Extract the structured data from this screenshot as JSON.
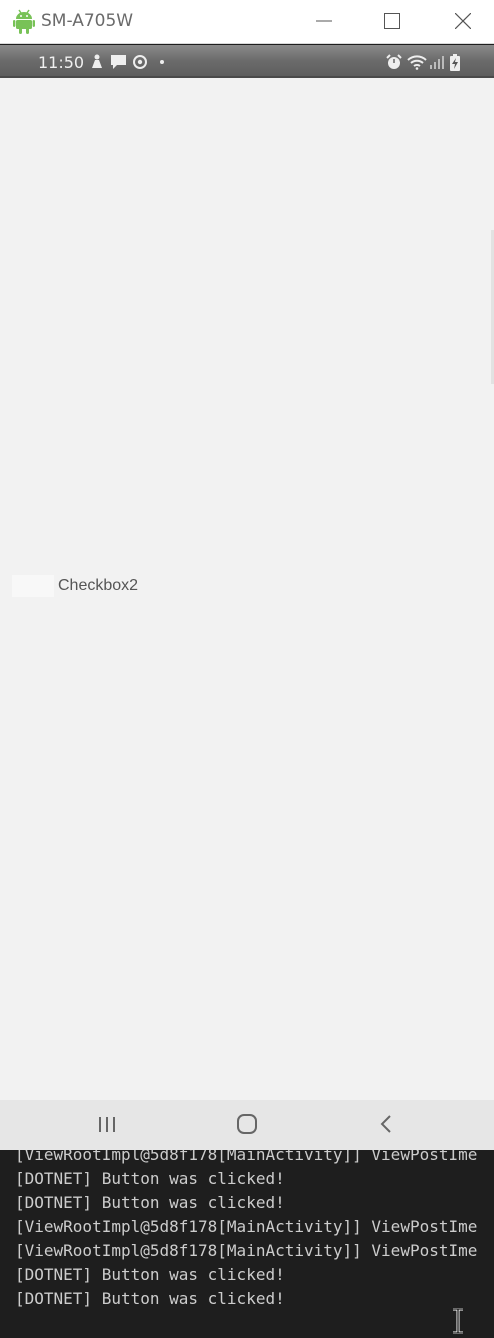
{
  "window": {
    "title": "SM-A705W",
    "icon": "android-icon",
    "controls": [
      "minimize-icon",
      "maximize-icon",
      "close-icon"
    ]
  },
  "status_bar": {
    "time": "11:50",
    "left_icons": [
      "notification-icon",
      "message-icon",
      "sync-icon",
      "dot-icon"
    ],
    "right_icons": [
      "alarm-icon",
      "wifi-icon",
      "signal-icon",
      "battery-charging-icon"
    ]
  },
  "screen": {
    "checkbox": {
      "label": "Checkbox2",
      "checked": false
    }
  },
  "nav_bar": {
    "icons": [
      "recents-icon",
      "home-icon",
      "back-icon"
    ]
  },
  "console": {
    "lines": [
      "[ViewRootImpl@5d8f178[MainActivity]] ViewPostIme",
      "[DOTNET] Button was clicked!",
      "[DOTNET] Button was clicked!",
      "[ViewRootImpl@5d8f178[MainActivity]] ViewPostIme",
      "[ViewRootImpl@5d8f178[MainActivity]] ViewPostIme",
      "[DOTNET] Button was clicked!",
      "[DOTNET] Button was clicked!"
    ]
  },
  "colors": {
    "android_green": "#78c257",
    "screen_bg": "#f2f2f2",
    "console_bg": "#1e1e1e"
  }
}
